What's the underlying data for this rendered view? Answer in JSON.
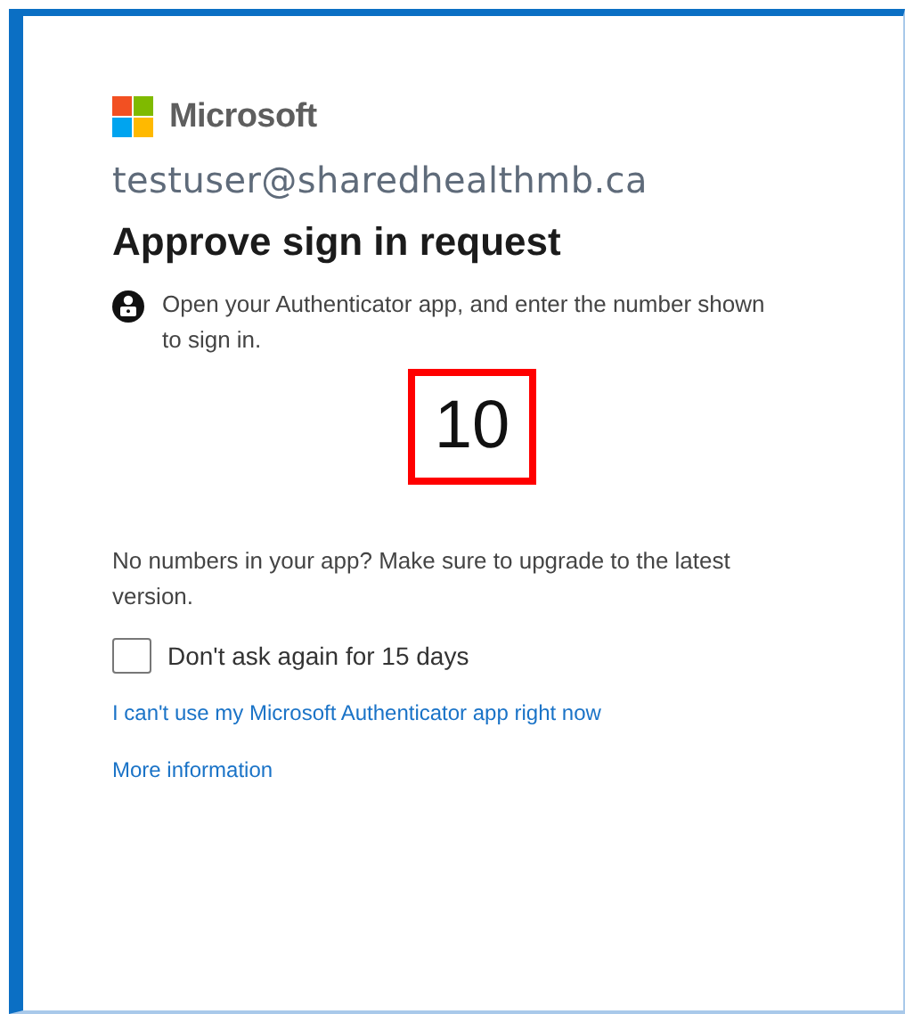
{
  "brand": {
    "name": "Microsoft"
  },
  "account": "testuser@sharedhealthmb.ca",
  "title": "Approve sign in request",
  "instruction": "Open your Authenticator app, and enter the number shown to sign in.",
  "number": "10",
  "note": "No numbers in your app? Make sure to upgrade to the latest version.",
  "remember": {
    "label": "Don't ask again for 15 days",
    "checked": false
  },
  "links": [
    "I can't use my Microsoft Authenticator app right now",
    "More information"
  ]
}
